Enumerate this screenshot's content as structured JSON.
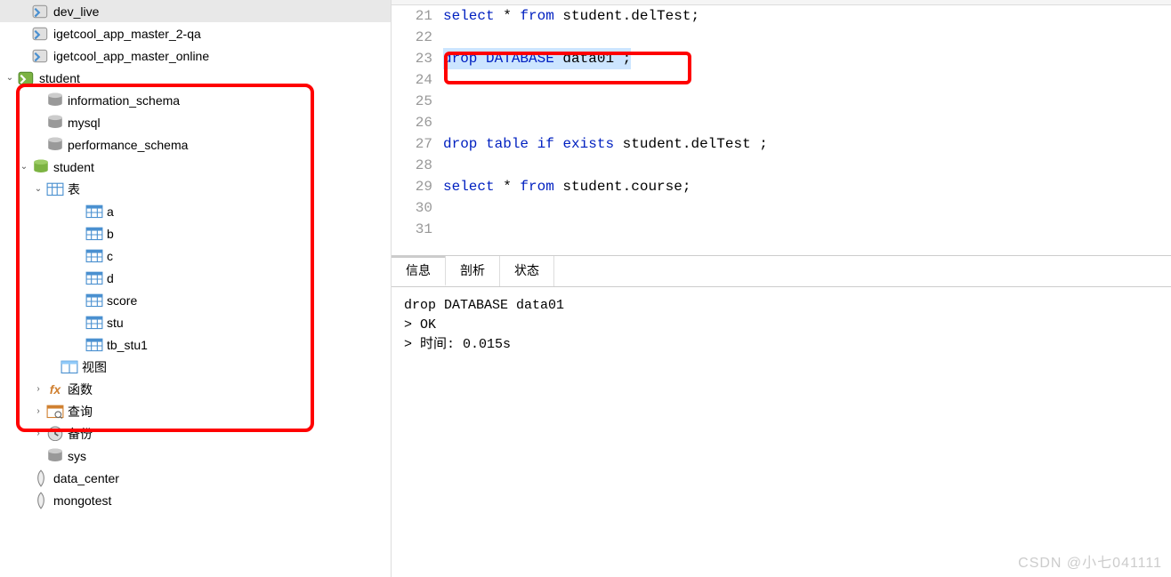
{
  "sidebar": {
    "connections": [
      {
        "name": "dev_live",
        "icon": "db-conn-grey",
        "indent": 1,
        "expand": ""
      },
      {
        "name": "igetcool_app_master_2-qa",
        "icon": "db-conn-grey",
        "indent": 1,
        "expand": ""
      },
      {
        "name": "igetcool_app_master_online",
        "icon": "db-conn-grey",
        "indent": 1,
        "expand": ""
      },
      {
        "name": "student",
        "icon": "db-conn-green",
        "indent": 0,
        "expand": "v"
      },
      {
        "name": "information_schema",
        "icon": "db-grey",
        "indent": 2,
        "expand": ""
      },
      {
        "name": "mysql",
        "icon": "db-grey",
        "indent": 2,
        "expand": ""
      },
      {
        "name": "performance_schema",
        "icon": "db-grey",
        "indent": 2,
        "expand": ""
      },
      {
        "name": "student",
        "icon": "db-green",
        "indent": 1,
        "expand": "v"
      },
      {
        "name": "表",
        "icon": "folder-table",
        "indent": 2,
        "expand": "v"
      },
      {
        "name": "a",
        "icon": "table",
        "indent": 4,
        "expand": ""
      },
      {
        "name": "b",
        "icon": "table",
        "indent": 4,
        "expand": ""
      },
      {
        "name": "c",
        "icon": "table",
        "indent": 4,
        "expand": ""
      },
      {
        "name": "d",
        "icon": "table",
        "indent": 4,
        "expand": ""
      },
      {
        "name": "score",
        "icon": "table",
        "indent": 4,
        "expand": ""
      },
      {
        "name": "stu",
        "icon": "table",
        "indent": 4,
        "expand": ""
      },
      {
        "name": "tb_stu1",
        "icon": "table",
        "indent": 4,
        "expand": ""
      },
      {
        "name": "视图",
        "icon": "view",
        "indent": 3,
        "expand": ""
      },
      {
        "name": "函数",
        "icon": "fx",
        "indent": 2,
        "expand": ">"
      },
      {
        "name": "查询",
        "icon": "query",
        "indent": 2,
        "expand": ">"
      },
      {
        "name": "备份",
        "icon": "backup",
        "indent": 2,
        "expand": ">"
      },
      {
        "name": "sys",
        "icon": "db-grey",
        "indent": 2,
        "expand": ""
      },
      {
        "name": "data_center",
        "icon": "mongo",
        "indent": 1,
        "expand": ""
      },
      {
        "name": "mongotest",
        "icon": "mongo",
        "indent": 1,
        "expand": ""
      }
    ]
  },
  "editor": {
    "lines": [
      {
        "num": "21",
        "tokens": [
          [
            "kw",
            "select"
          ],
          [
            "normal",
            " * "
          ],
          [
            "kw",
            "from"
          ],
          [
            "normal",
            " student.delTest;"
          ]
        ]
      },
      {
        "num": "22",
        "tokens": []
      },
      {
        "num": "23",
        "tokens": [
          [
            "kw",
            "drop"
          ],
          [
            "normal",
            " "
          ],
          [
            "kw",
            "DATABASE"
          ],
          [
            "normal",
            " data01 ;"
          ]
        ],
        "highlighted": true
      },
      {
        "num": "24",
        "tokens": []
      },
      {
        "num": "25",
        "tokens": []
      },
      {
        "num": "26",
        "tokens": []
      },
      {
        "num": "27",
        "tokens": [
          [
            "kw",
            "drop"
          ],
          [
            "normal",
            " "
          ],
          [
            "kw",
            "table"
          ],
          [
            "normal",
            " "
          ],
          [
            "kw",
            "if"
          ],
          [
            "normal",
            " "
          ],
          [
            "kw",
            "exists"
          ],
          [
            "normal",
            " student.delTest ;"
          ]
        ]
      },
      {
        "num": "28",
        "tokens": []
      },
      {
        "num": "29",
        "tokens": [
          [
            "kw",
            "select"
          ],
          [
            "normal",
            " * "
          ],
          [
            "kw",
            "from"
          ],
          [
            "normal",
            " student.course;"
          ]
        ]
      },
      {
        "num": "30",
        "tokens": []
      },
      {
        "num": "31",
        "tokens": []
      }
    ]
  },
  "tabs": {
    "items": [
      "信息",
      "剖析",
      "状态"
    ],
    "active": 0
  },
  "output": {
    "line1": "drop DATABASE data01",
    "line2": "> OK",
    "line3": "> 时间: 0.015s"
  },
  "watermark": "CSDN @小七041111"
}
